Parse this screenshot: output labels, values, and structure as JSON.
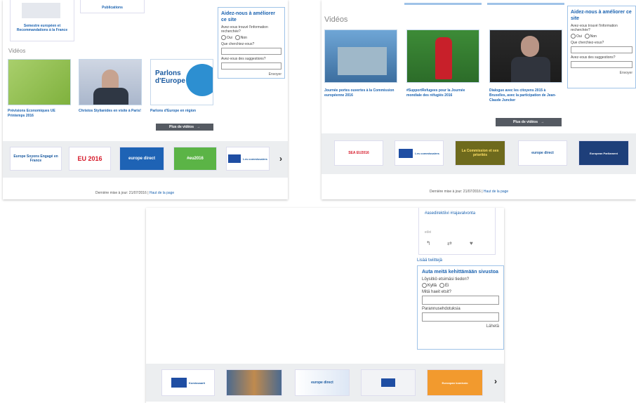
{
  "fr": {
    "top_card_text": "Semestre européen et Recommandations à la France",
    "publications_label": "Publications",
    "videos_heading": "Vidéos",
    "videos": [
      {
        "caption": "Prévisions Economiques UE Printemps 2016"
      },
      {
        "caption": "Christos Stylianides en visite à Paris!"
      },
      {
        "caption": "Parlons d'Europe en région",
        "thumb_text": "Parlons d'Europe"
      }
    ],
    "more_button": "Plus de vidéos",
    "feedback": {
      "title": "Aidez-nous à améliorer ce site",
      "question": "Avez-vous trouvé l'information recherchée?",
      "yes": "Oui",
      "no": "Non",
      "looking_for": "Que cherchiez-vous?",
      "suggestions": "Avez-vous des suggestions?",
      "send": "Envoyer"
    },
    "logos": [
      "Europe Soyons Engagé en France",
      "EU 2016",
      "europe direct",
      "#eu2016",
      "Les commissaires"
    ],
    "footer_updated": "Dernière mise à jour: 21/07/2016",
    "footer_link": "Haut de la page"
  },
  "be": {
    "videos_heading": "Vidéos",
    "videos": [
      {
        "caption": "Journée portes ouvertes à la Commission européenne 2016"
      },
      {
        "caption": "#SupportRefugees pour la Journée mondiale des réfugiés 2016"
      },
      {
        "caption": "Dialogue avec les citoyens 2015 à Bruxelles, avec la participation de Jean-Claude Juncker"
      }
    ],
    "more_button": "Plus de vidéos",
    "feedback": {
      "title": "Aidez-nous à améliorer ce site",
      "question": "Avez-vous trouvé l'information recherchée?",
      "yes": "Oui",
      "no": "Non",
      "looking_for": "Que cherchiez-vous?",
      "suggestions": "Avez-vous des suggestions?",
      "send": "Envoyer"
    },
    "logos": [
      "SEA EU2016",
      "Les commissaires",
      "La Commission et ses priorités",
      "europe direct",
      "European Parliament"
    ],
    "footer_updated": "Dernière mise à jour: 21/07/2016",
    "footer_link": "Haut de la page"
  },
  "fi": {
    "tweet_text": "#asedirektiivi #rajavalvonta",
    "tweet_time": "ei/ei",
    "tweet_list_link": "Lisää twiittejä",
    "feedback": {
      "title": "Auta meitä kehittämään sivustoa",
      "question": "Löysitkö etsimäsi tiedon?",
      "yes": "Kyllä",
      "no": "Ei",
      "looking_for": "Mitä haeit etsit?",
      "suggestions": "Parannusehdotuksia",
      "send": "Lähetä"
    },
    "logos": [
      "Komissaarit",
      "",
      "europe direct",
      "",
      "Euroopan komissio"
    ]
  },
  "colors": {
    "link": "#1a62b0",
    "button": "#555a62",
    "carousel": "#eceef0"
  }
}
